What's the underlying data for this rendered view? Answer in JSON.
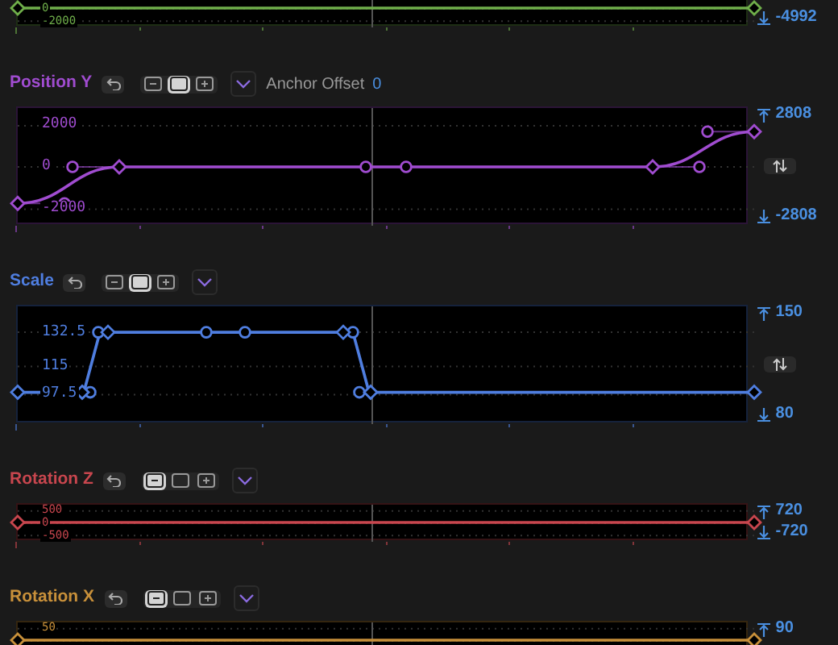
{
  "tracks": [
    {
      "color": "#6fae4a",
      "kind": "flat",
      "axis_labels": [
        {
          "kind": "mid",
          "text": "0"
        },
        {
          "kind": "bottom",
          "text": "-2000"
        }
      ],
      "min": "-4992"
    },
    {
      "name": "Position Y",
      "color": "#a04cd0",
      "kind": "s-curve",
      "size_buttons": [
        {
          "selected": false
        },
        {
          "selected": true
        },
        {
          "selected": false
        }
      ],
      "anchor_offset": {
        "label": "Anchor Offset",
        "value": "0"
      },
      "axis_labels": [
        {
          "kind": "top",
          "text": "2000"
        },
        {
          "kind": "mid",
          "text": "0"
        },
        {
          "kind": "bottom",
          "text": "-2000"
        }
      ],
      "max": "2808",
      "min": "-2808",
      "swap": true
    },
    {
      "name": "Scale",
      "color": "#4f7ee0",
      "kind": "plateau",
      "size_buttons": [
        {
          "selected": false
        },
        {
          "selected": true
        },
        {
          "selected": false
        }
      ],
      "axis_labels": [
        {
          "kind": "top",
          "text": "132.5"
        },
        {
          "kind": "mid",
          "text": "115"
        },
        {
          "kind": "bottom",
          "text": "97.5"
        }
      ],
      "max": "150",
      "min": "80",
      "swap": true
    },
    {
      "name": "Rotation Z",
      "color": "#c8464e",
      "kind": "flat",
      "size_buttons": [
        {
          "selected": true
        },
        {
          "selected": false
        },
        {
          "selected": false
        }
      ],
      "axis_labels": [
        {
          "kind": "top",
          "text": "500"
        },
        {
          "kind": "mid",
          "text": "0"
        },
        {
          "kind": "bottom",
          "text": "-500"
        }
      ],
      "max": "720",
      "min": "-720"
    },
    {
      "name": "Rotation X",
      "color": "#c8903a",
      "kind": "flat",
      "size_buttons": [
        {
          "selected": true
        },
        {
          "selected": false
        },
        {
          "selected": false
        }
      ],
      "axis_labels": [
        {
          "kind": "top",
          "text": "50"
        }
      ],
      "max": "90"
    }
  ]
}
